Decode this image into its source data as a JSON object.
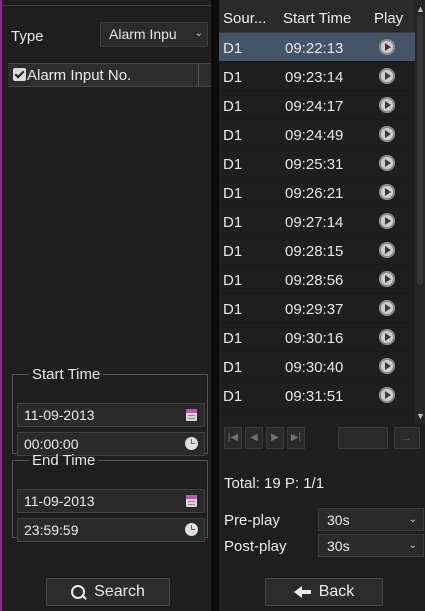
{
  "search_panel": {
    "type_label": "Type",
    "type_value": "Alarm Inpu",
    "alarm_input_label": "Alarm Input No.",
    "alarm_input_checked": true,
    "start_time": {
      "legend": "Start Time",
      "date": "11-09-2013",
      "time": "00:00:00"
    },
    "end_time": {
      "legend": "End Time",
      "date": "11-09-2013",
      "time": "23:59:59"
    },
    "search_label": "Search",
    "accent_color": "#8e2b83"
  },
  "results_panel": {
    "columns": {
      "source": "Sour...",
      "start_time": "Start Time",
      "play": "Play"
    },
    "rows": [
      {
        "source": "D1",
        "start_time": "09:22:13",
        "selected": true
      },
      {
        "source": "D1",
        "start_time": "09:23:14"
      },
      {
        "source": "D1",
        "start_time": "09:24:17"
      },
      {
        "source": "D1",
        "start_time": "09:24:49"
      },
      {
        "source": "D1",
        "start_time": "09:25:31"
      },
      {
        "source": "D1",
        "start_time": "09:26:21"
      },
      {
        "source": "D1",
        "start_time": "09:27:14"
      },
      {
        "source": "D1",
        "start_time": "09:28:15"
      },
      {
        "source": "D1",
        "start_time": "09:28:56"
      },
      {
        "source": "D1",
        "start_time": "09:29:37"
      },
      {
        "source": "D1",
        "start_time": "09:30:16"
      },
      {
        "source": "D1",
        "start_time": "09:30:40"
      },
      {
        "source": "D1",
        "start_time": "09:31:51"
      }
    ],
    "total_text": "Total: 19  P: 1/1",
    "preplay_label": "Pre-play",
    "preplay_value": "30s",
    "postplay_label": "Post-play",
    "postplay_value": "30s",
    "back_label": "Back",
    "selected_row_color": "#445569"
  }
}
